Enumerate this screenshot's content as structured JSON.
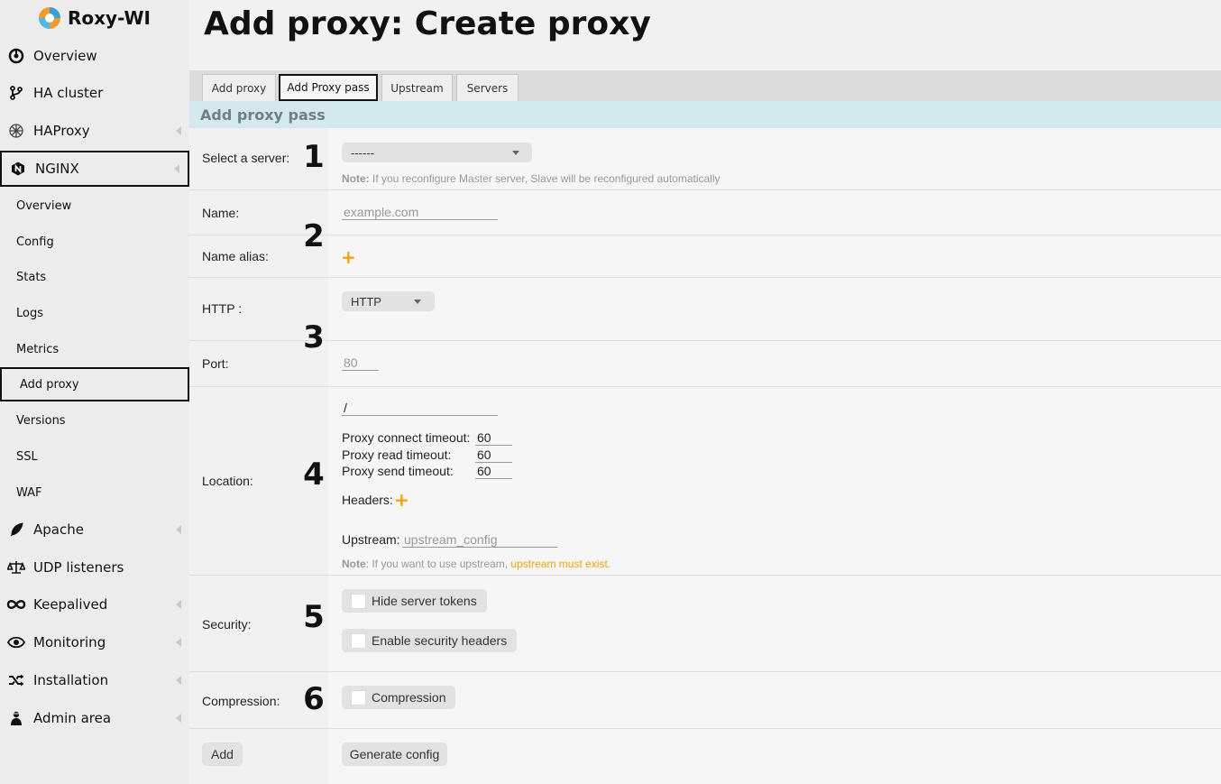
{
  "app": {
    "name": "Roxy-WI"
  },
  "sidebar": {
    "items": [
      {
        "label": "Overview",
        "icon": "overview-icon"
      },
      {
        "label": "HA cluster",
        "icon": "branch-icon"
      },
      {
        "label": "HAProxy",
        "icon": "haproxy-icon"
      },
      {
        "label": "NGINX",
        "icon": "nginx-icon"
      },
      {
        "label": "Apache",
        "icon": "feather-icon"
      },
      {
        "label": "UDP listeners",
        "icon": "scale-icon"
      },
      {
        "label": "Keepalived",
        "icon": "infinity-icon"
      },
      {
        "label": "Monitoring",
        "icon": "eye-icon"
      },
      {
        "label": "Installation",
        "icon": "shuffle-icon"
      },
      {
        "label": "Admin area",
        "icon": "admin-icon"
      }
    ],
    "nginx_sub": [
      "Overview",
      "Config",
      "Stats",
      "Logs",
      "Metrics",
      "Add proxy",
      "Versions",
      "SSL",
      "WAF"
    ]
  },
  "page": {
    "title": "Add proxy: Create proxy"
  },
  "tabs": [
    "Add proxy",
    "Add Proxy pass",
    "Upstream",
    "Servers"
  ],
  "section": {
    "title": "Add proxy pass"
  },
  "form": {
    "server": {
      "label": "Select a server:",
      "value": "------",
      "note_bold": "Note:",
      "note": " If you reconfigure Master server, Slave will be reconfigured automatically"
    },
    "name": {
      "label": "Name:",
      "placeholder": "example.com"
    },
    "alias": {
      "label": "Name alias:",
      "plus": "+"
    },
    "http": {
      "label": "HTTP :",
      "value": "HTTP"
    },
    "port": {
      "label": "Port:",
      "placeholder": "80"
    },
    "location": {
      "label": "Location:",
      "value": "/",
      "connect_label": "Proxy connect timeout:",
      "connect_value": "60",
      "read_label": "Proxy read timeout:",
      "read_value": "60",
      "send_label": "Proxy send timeout:",
      "send_value": "60",
      "headers_label": "Headers:",
      "headers_plus": "+",
      "upstream_label": "Upstream:",
      "upstream_placeholder": "upstream_config",
      "note_bold": "Note",
      "note": ": If you want to use upstream, ",
      "note_link": "upstream must exist",
      "note_end": "."
    },
    "security": {
      "label": "Security:",
      "hide_tokens": "Hide server tokens",
      "security_headers": "Enable security headers"
    },
    "compression": {
      "label": "Compression:",
      "option": "Compression"
    },
    "add_button": "Add",
    "generate_button": "Generate config"
  },
  "steps": [
    "1",
    "2",
    "3",
    "4",
    "5",
    "6"
  ]
}
